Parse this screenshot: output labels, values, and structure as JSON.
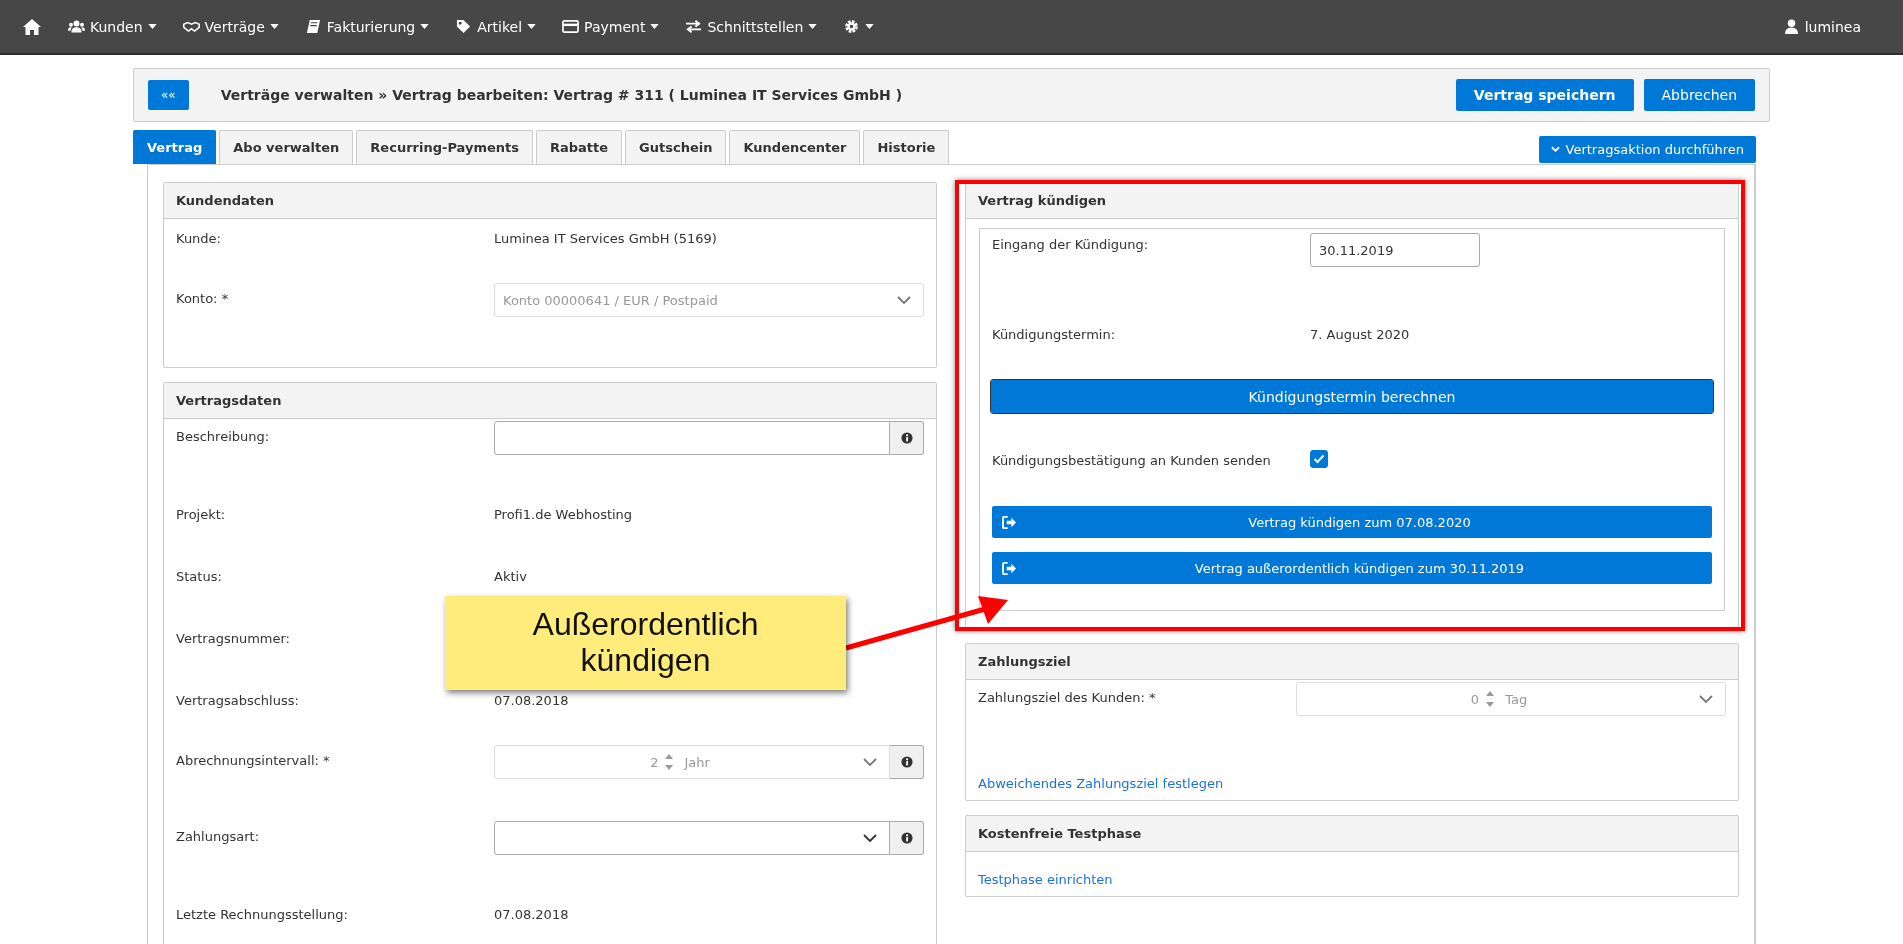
{
  "nav": {
    "items": [
      {
        "label": "Kunden"
      },
      {
        "label": "Verträge"
      },
      {
        "label": "Fakturierung"
      },
      {
        "label": "Artikel"
      },
      {
        "label": "Payment"
      },
      {
        "label": "Schnittstellen"
      }
    ],
    "user": "luminea"
  },
  "header": {
    "back": "««",
    "title": "Verträge verwalten » Vertrag bearbeiten: Vertrag # 311 ( Luminea IT Services GmbH )",
    "save": "Vertrag speichern",
    "cancel": "Abbrechen"
  },
  "tabs": [
    {
      "label": "Vertrag",
      "selected": true
    },
    {
      "label": "Abo verwalten",
      "selected": false
    },
    {
      "label": "Recurring-Payments",
      "selected": false
    },
    {
      "label": "Rabatte",
      "selected": false
    },
    {
      "label": "Gutschein",
      "selected": false
    },
    {
      "label": "Kundencenter",
      "selected": false
    },
    {
      "label": "Historie",
      "selected": false
    }
  ],
  "action_button": "Vertragsaktion durchführen",
  "left_panels": [
    {
      "title": "Kundendaten",
      "boxed": false,
      "rows": [
        {
          "kind": "text",
          "label": "Kunde:",
          "value": "Luminea IT Services GmbH (5169)"
        },
        {
          "kind": "select",
          "label": "Konto: *",
          "value": "Konto 00000641 / EUR / Postpaid",
          "disabled": true,
          "info": false
        }
      ]
    },
    {
      "title": "Vertragsdaten",
      "boxed": false,
      "rows": [
        {
          "kind": "input",
          "label": "Beschreibung:",
          "info": true
        },
        {
          "kind": "text",
          "label": "Projekt:",
          "value": "Profi1.de Webhosting"
        },
        {
          "kind": "text",
          "label": "Status:",
          "value": "Aktiv"
        },
        {
          "kind": "text",
          "label": "Vertragsnummer:"
        },
        {
          "kind": "text",
          "label": "Vertragsabschluss:",
          "value": "07.08.2018"
        },
        {
          "kind": "spinner",
          "label": "Abrechnungsintervall: *",
          "number": "2",
          "unit": "Jahr",
          "disabled": true,
          "info": true
        },
        {
          "kind": "select",
          "label": "Zahlungsart:",
          "disabled": false,
          "info": true
        },
        {
          "kind": "text",
          "label": "Letzte Rechnungsstellung:",
          "value": "07.08.2018"
        }
      ]
    }
  ],
  "right_panels": [
    {
      "title": "Vertrag kündigen",
      "boxed": true,
      "rows": [
        {
          "kind": "input",
          "label": "Eingang der Kündigung:",
          "value": "30.11.2019",
          "info": false
        },
        {
          "kind": "text",
          "label": "Kündigungstermin:",
          "value": "7. August 2020"
        },
        {
          "kind": "button",
          "label": "Kündigungstermin berechnen"
        },
        {
          "kind": "checkbox",
          "label": "Kündigungsbestätigung an Kunden senden",
          "checked": true
        },
        {
          "kind": "action",
          "label": "Vertrag kündigen zum 07.08.2020"
        },
        {
          "kind": "action",
          "label": "Vertrag außerordentlich kündigen zum 30.11.2019"
        }
      ]
    },
    {
      "title": "Zahlungsziel",
      "boxed": false,
      "rows": [
        {
          "kind": "spinner",
          "label": "Zahlungsziel des Kunden: *",
          "number": "0",
          "unit": "Tag",
          "disabled": true,
          "info": false
        },
        {
          "kind": "link",
          "label": "Abweichendes Zahlungsziel festlegen"
        }
      ]
    },
    {
      "title": "Kostenfreie Testphase",
      "boxed": false,
      "rows": [
        {
          "kind": "link",
          "label": "Testphase einrichten"
        }
      ]
    }
  ],
  "annotation": {
    "text": "Außerordentlich kündigen"
  }
}
